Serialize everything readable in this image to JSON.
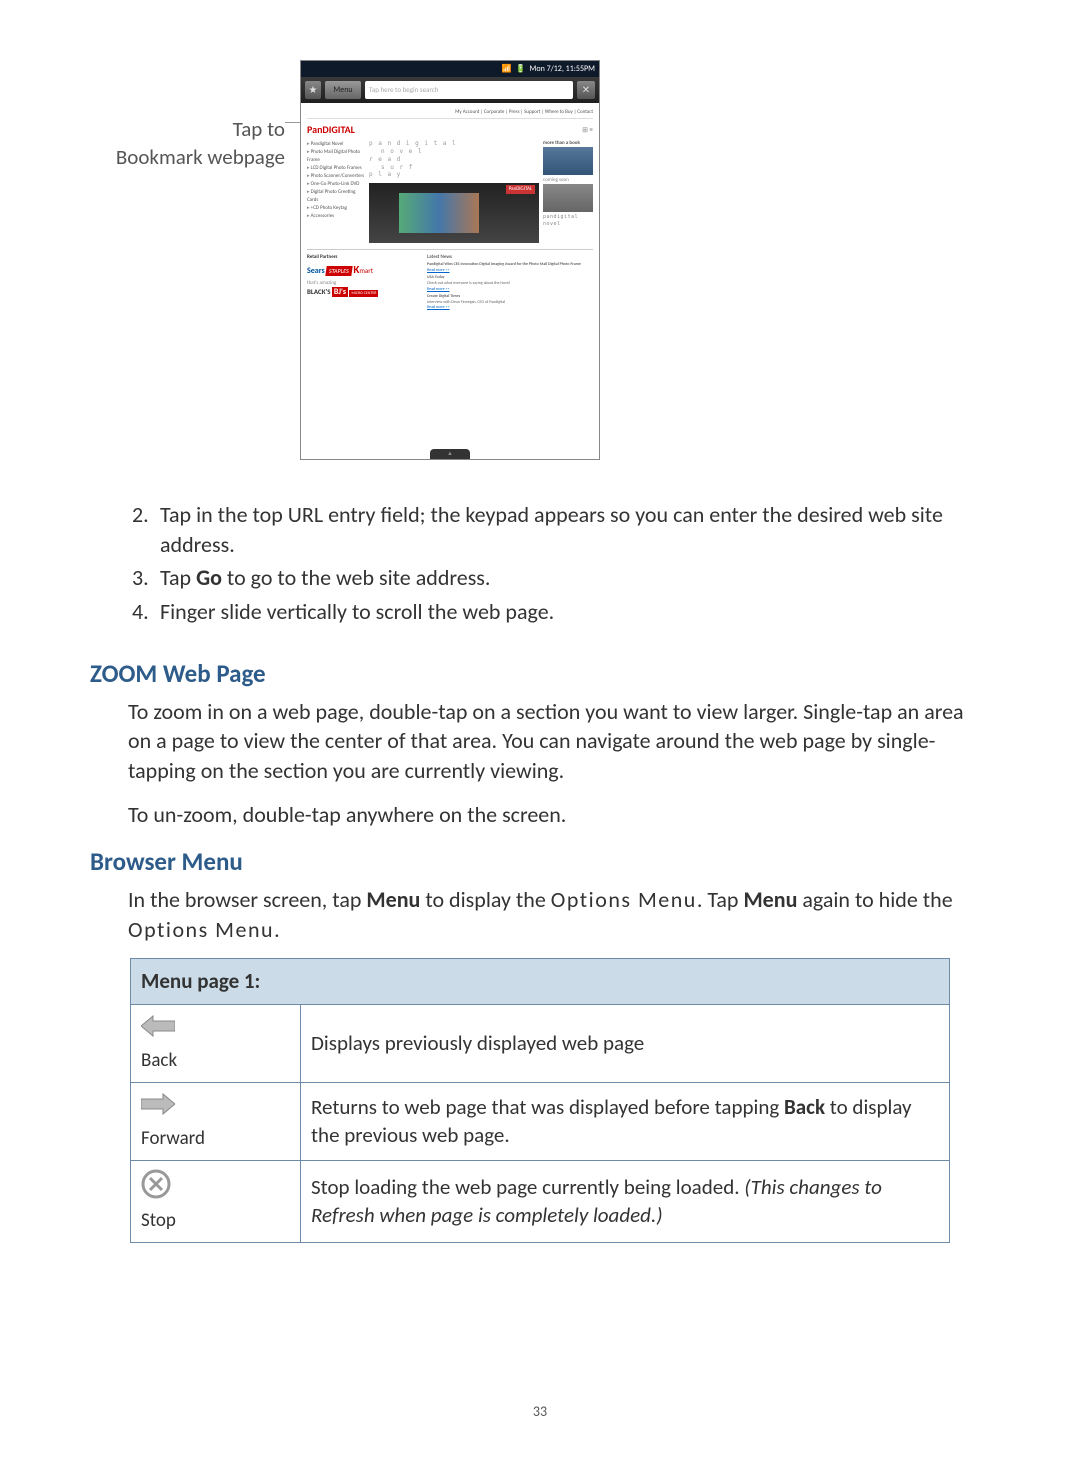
{
  "callout": {
    "line1": "Tap to",
    "line2": "Bookmark webpage"
  },
  "screenshot": {
    "statusbar": {
      "time": "Mon 7/12, 11:55PM"
    },
    "urlbar": {
      "menu_label": "Menu",
      "placeholder": "Tap here to begin search"
    },
    "page": {
      "brand": "PanDIGITAL",
      "topnav": "My Account | Corporate | Press | Support | Where to Buy | Contact",
      "sidebar_items": [
        "Pandigital Novel",
        "Photo Mail Digital Photo Frame",
        "LCD Digital Photo Frames",
        "Photo Scanner/Converters",
        "One-Go Photo-Link DVD",
        "Digital Photo Greeting Cards",
        "+CD Photo Keytag",
        "Accessories"
      ],
      "slogan_lines": [
        "p a n d i g i t a l",
        "n o v e l",
        "r e a d",
        "s u r f",
        "p l a y"
      ],
      "side_right_text": "more than a book",
      "side_right_text2": "coming soon",
      "side_right_text3": "pandigital novel",
      "retail_header_left": "Retail Partners",
      "retail_header_right": "Latest News",
      "partners": [
        "Sears",
        "STAPLES",
        "kmart",
        "BLACK'S",
        "BJ's",
        "MICRO CENTER"
      ],
      "news_items": [
        "Pandigital Wins CES Innovation Digital Imaging Award for the Photo Mail Digital Photo Frame",
        "Read more >>",
        "USA Today",
        "Check out what everyone is saying about the Novel",
        "Read more >>",
        "Create Digital Times",
        "Interview with Dean Finnegan, CEO of Pandigital",
        "Read more >>"
      ]
    }
  },
  "instructions": [
    {
      "num": "2.",
      "text_a": "Tap in the top URL entry field; the keypad appears so you can enter the desired web site address."
    },
    {
      "num": "3.",
      "text_a": "Tap ",
      "bold": "Go",
      "text_b": " to go to the web site address."
    },
    {
      "num": "4.",
      "text_a": "Finger slide vertically to scroll the web page."
    }
  ],
  "sections": {
    "zoom": {
      "heading": "ZOOM Web Page",
      "para1": "To zoom in on a web page, double-tap on a section you want to view larger. Single-tap an area on a page to view the center of that area. You can navigate around the web page by single-tapping on the section you are currently viewing.",
      "para2": "To un-zoom, double-tap anywhere on the screen."
    },
    "browser_menu": {
      "heading": "Browser Menu",
      "para_a": "In the browser screen, tap ",
      "para_bold1": "Menu",
      "para_b": " to display the ",
      "para_spaced1": "Options Menu",
      "para_c": ". Tap ",
      "para_bold2": "Menu",
      "para_d": " again to hide the ",
      "para_spaced2": "Options Menu",
      "para_e": "."
    }
  },
  "menu_table": {
    "header": "Menu page 1:",
    "rows": [
      {
        "icon": "back-arrow",
        "label": "Back",
        "desc": "Displays previously displayed web page"
      },
      {
        "icon": "forward-arrow",
        "label": "Forward",
        "desc_a": "Returns to web page that was displayed before tapping ",
        "desc_bold": "Back",
        "desc_b": " to display the previous web page."
      },
      {
        "icon": "stop",
        "label": "Stop",
        "desc_a": "Stop loading the web page currently being loaded. ",
        "desc_italic": "(This changes to Refresh when page is completely loaded.)"
      }
    ]
  },
  "page_number": "33"
}
